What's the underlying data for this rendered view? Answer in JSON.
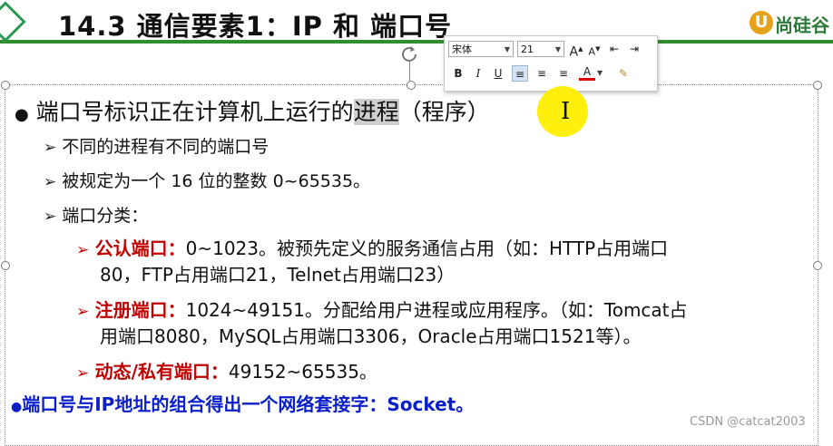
{
  "slide": {
    "title": "14.3 通信要素1：IP 和 端口号",
    "logo_text": "尚硅谷",
    "bullets": [
      {
        "prefix": "端口号标识正在计算机上运行的",
        "highlight": "进程",
        "suffix": "（程序）"
      },
      {
        "text": "不同的进程有不同的端口号"
      },
      {
        "text": "被规定为一个 16 位的整数 0~65535。"
      },
      {
        "text": "端口分类："
      }
    ],
    "categories": [
      {
        "label": "公认端口：",
        "line1": "0~1023。被预先定义的服务通信占用（如：HTTP占用端口",
        "line2": "80，FTP占用端口21，Telnet占用端口23）"
      },
      {
        "label": "注册端口：",
        "line1": "1024~49151。分配给用户进程或应用程序。（如：Tomcat占",
        "line2": "用端口8080，MySQL占用端口3306，Oracle占用端口1521等）。"
      },
      {
        "label": "动态/私有端口：",
        "line1": "49152~65535。"
      }
    ],
    "socket_line": "端口号与IP地址的组合得出一个网络套接字：Socket。"
  },
  "toolbar": {
    "font_name": "宋体",
    "font_size": "21",
    "grow_font": "A",
    "shrink_font": "A",
    "bold": "B",
    "italic": "I",
    "underline": "U",
    "font_color": "A"
  },
  "watermark": "CSDN @catcat2003",
  "colors": {
    "accent_green": "#2f8f2f",
    "red": "#c00000",
    "blue": "#0a1fc7",
    "cursor_highlight": "#ffee00"
  }
}
